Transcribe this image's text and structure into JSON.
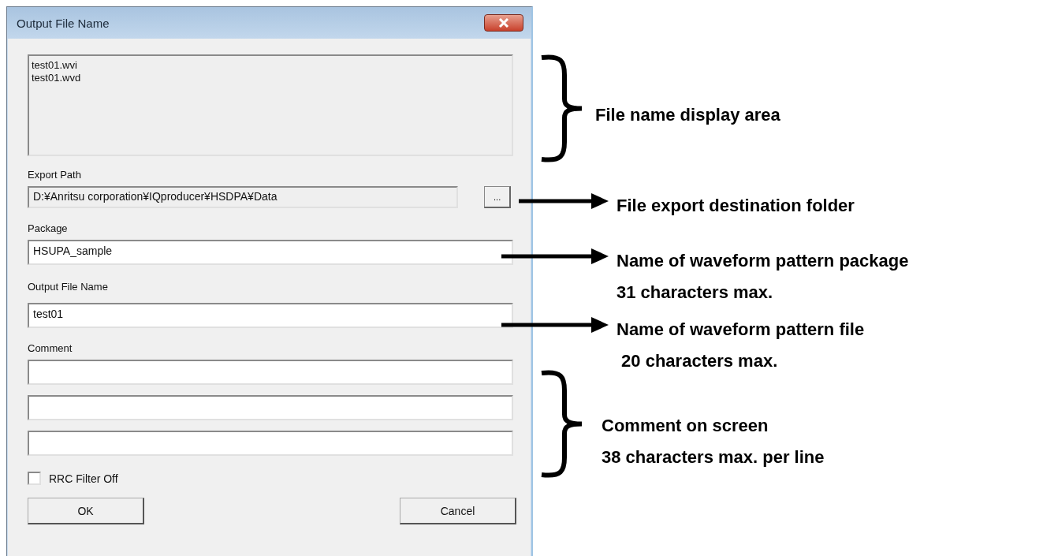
{
  "window": {
    "title": "Output File Name"
  },
  "file_list": {
    "lines": [
      "test01.wvi",
      "test01.wvd"
    ]
  },
  "export_path": {
    "label": "Export Path",
    "value": "D:¥Anritsu corporation¥IQproducer¥HSDPA¥Data",
    "browse_button": "..."
  },
  "package": {
    "label": "Package",
    "value": "HSUPA_sample"
  },
  "output_file_name": {
    "label": "Output File Name",
    "value": "test01"
  },
  "comment": {
    "label": "Comment"
  },
  "rrc_filter_off": {
    "label": "RRC Filter Off",
    "checked": false
  },
  "buttons": [
    {
      "label": "OK"
    },
    {
      "label": "Cancel"
    }
  ],
  "annotations": [
    {
      "kind": "brace",
      "lines": [
        "File name display area"
      ]
    },
    {
      "kind": "arrow",
      "lines": [
        "File export destination folder"
      ]
    },
    {
      "kind": "arrow",
      "lines": [
        "Name of waveform pattern package",
        "31 characters max."
      ]
    },
    {
      "kind": "arrow",
      "lines": [
        "Name of waveform pattern file",
        " 20 characters max."
      ]
    },
    {
      "kind": "brace",
      "lines": [
        "Comment on screen",
        "38 characters max. per line"
      ]
    }
  ]
}
